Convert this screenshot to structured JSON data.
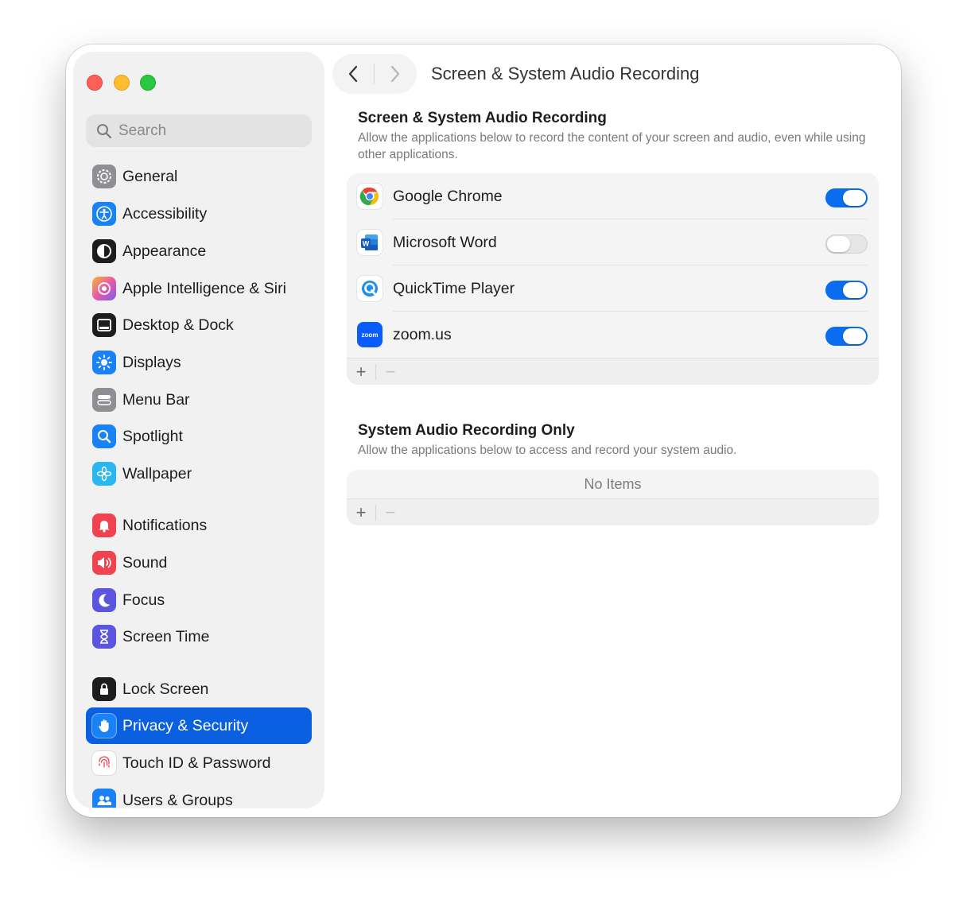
{
  "window": {
    "title": "Screen & System Audio Recording"
  },
  "search": {
    "placeholder": "Search",
    "icon": "magnifier-icon"
  },
  "sidebar": {
    "items": [
      {
        "label": "General",
        "icon": "gear-icon",
        "color": "#8e8e93"
      },
      {
        "label": "Accessibility",
        "icon": "accessibility-icon",
        "color": "#1a82f7"
      },
      {
        "label": "Appearance",
        "icon": "appearance-icon",
        "color": "#1d1d1f"
      },
      {
        "label": "Apple Intelligence & Siri",
        "icon": "siri-icon",
        "color": "#e95aa6"
      },
      {
        "label": "Desktop & Dock",
        "icon": "dock-icon",
        "color": "#1d1d1f"
      },
      {
        "label": "Displays",
        "icon": "sun-icon",
        "color": "#1a82f7"
      },
      {
        "label": "Menu Bar",
        "icon": "menubar-icon",
        "color": "#8e8e93"
      },
      {
        "label": "Spotlight",
        "icon": "magnifier-icon",
        "color": "#1a82f7"
      },
      {
        "label": "Wallpaper",
        "icon": "flower-icon",
        "color": "#2ab6f0"
      },
      {
        "label": "Notifications",
        "icon": "bell-icon",
        "color": "#f0424f"
      },
      {
        "label": "Sound",
        "icon": "speaker-icon",
        "color": "#f0424f"
      },
      {
        "label": "Focus",
        "icon": "moon-icon",
        "color": "#5b55e0"
      },
      {
        "label": "Screen Time",
        "icon": "hourglass-icon",
        "color": "#5b55e0"
      },
      {
        "label": "Lock Screen",
        "icon": "lock-icon",
        "color": "#1d1d1f"
      },
      {
        "label": "Privacy & Security",
        "icon": "hand-icon",
        "color": "#1a82f7",
        "active": true
      },
      {
        "label": "Touch ID & Password",
        "icon": "fingerprint-icon",
        "color": "#ffffff"
      },
      {
        "label": "Users & Groups",
        "icon": "users-icon",
        "color": "#1a82f7"
      }
    ]
  },
  "screen_section": {
    "title": "Screen & System Audio Recording",
    "description": "Allow the applications below to record the content of your screen and audio, even while using other applications.",
    "apps": [
      {
        "name": "Google Chrome",
        "enabled": true,
        "icon": "chrome-icon"
      },
      {
        "name": "Microsoft Word",
        "enabled": false,
        "icon": "word-icon"
      },
      {
        "name": "QuickTime Player",
        "enabled": true,
        "icon": "quicktime-icon"
      },
      {
        "name": "zoom.us",
        "enabled": true,
        "icon": "zoom-icon",
        "icon_text": "zoom"
      }
    ],
    "add_label": "+",
    "remove_label": "−"
  },
  "audio_section": {
    "title": "System Audio Recording Only",
    "description": "Allow the applications below to access and record your system audio.",
    "empty_label": "No Items",
    "add_label": "+",
    "remove_label": "−"
  },
  "colors": {
    "accent": "#0a60e0",
    "toggle_on": "#0a6df0"
  }
}
